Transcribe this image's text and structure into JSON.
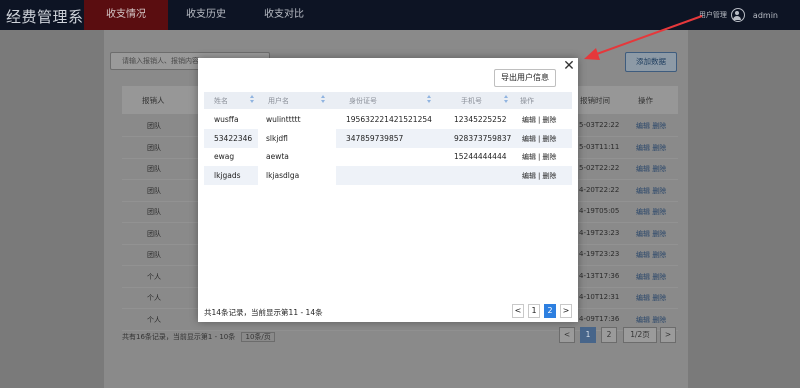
{
  "header": {
    "app_title": "经费管理系统",
    "tabs": [
      {
        "label": "收支情况",
        "active": true
      },
      {
        "label": "收支历史",
        "active": false
      },
      {
        "label": "收支对比",
        "active": false
      }
    ],
    "user_menu_label": "用户管理",
    "username": "admin"
  },
  "background_page": {
    "search_placeholder": "请输入报销人、报销内容",
    "add_button": "添加数据",
    "columns": [
      "报销人",
      "报销时间",
      "操作"
    ],
    "rows": [
      {
        "type": "团队",
        "time": "5-03T22:22",
        "actions": "编辑 删除"
      },
      {
        "type": "团队",
        "time": "5-03T11:11",
        "actions": "编辑 删除"
      },
      {
        "type": "团队",
        "time": "5-02T22:22",
        "actions": "编辑 删除"
      },
      {
        "type": "团队",
        "time": "4-20T22:22",
        "actions": "编辑 删除"
      },
      {
        "type": "团队",
        "time": "4-19T05:05",
        "actions": "编辑 删除"
      },
      {
        "type": "团队",
        "time": "4-19T23:23",
        "actions": "编辑 删除"
      },
      {
        "type": "团队",
        "time": "4-19T23:23",
        "actions": "编辑 删除"
      },
      {
        "type": "个人",
        "time": "4-13T17:36",
        "actions": "编辑 删除"
      },
      {
        "type": "个人",
        "time": "4-10T12:31",
        "actions": "编辑 删除"
      },
      {
        "type": "个人",
        "time": "4-09T17:36",
        "actions": "编辑 删除"
      }
    ],
    "footer_text": "共有16条记录，当前显示第1 - 10条",
    "page_size": "10条/页",
    "pagination": [
      "<",
      "1",
      "2",
      "1/2页",
      ">"
    ]
  },
  "modal": {
    "export_button": "导出用户信息",
    "close_icon": "close-icon",
    "columns": [
      "姓名",
      "用户名",
      "身份证号",
      "手机号",
      "操作"
    ],
    "rows": [
      {
        "name": "wusffa",
        "username": "wulinttttt",
        "id_number": "195632221421521254",
        "phone": "12345225252",
        "edit": "编辑",
        "sep": "|",
        "delete": "删除"
      },
      {
        "name": "53422346",
        "username": "slkjdfl",
        "id_number": "347859739857",
        "phone": "928373759837",
        "edit": "编辑",
        "sep": "|",
        "delete": "删除"
      },
      {
        "name": "ewag",
        "username": "aewta",
        "id_number": "",
        "phone": "15244444444",
        "edit": "编辑",
        "sep": "|",
        "delete": "删除"
      },
      {
        "name": "lkjgads",
        "username": "lkjasdlga",
        "id_number": "",
        "phone": "",
        "edit": "编辑",
        "sep": "|",
        "delete": "删除"
      }
    ],
    "footer_text": "共14条记录，当前显示第11 - 14条",
    "pagination": {
      "prev": "<",
      "pages": [
        "1",
        "2"
      ],
      "current": "2",
      "next": ">"
    }
  },
  "colors": {
    "topbar": "#0d1424",
    "active_tab": "#5a0d10",
    "accent_blue": "#2d7fe0",
    "annotation_arrow": "#e5383b"
  }
}
